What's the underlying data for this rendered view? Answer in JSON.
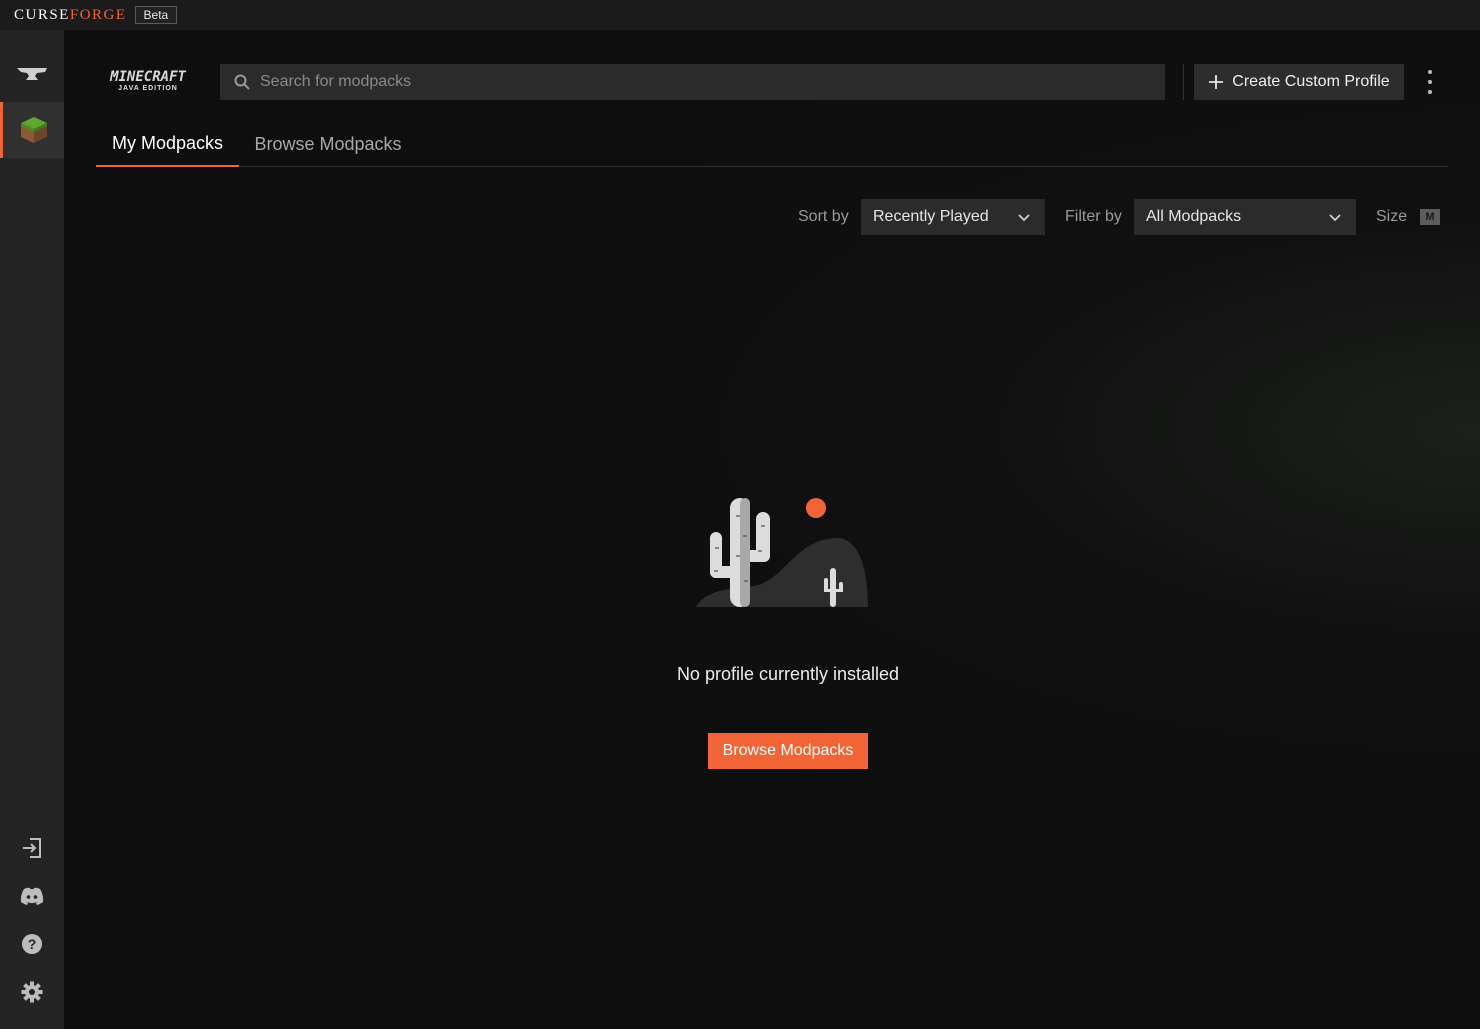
{
  "app": {
    "brand_curse": "CURSE",
    "brand_forge": "FORGE",
    "beta_label": "Beta"
  },
  "game": {
    "logo_line1": "MINECRAFT",
    "logo_line2": "JAVA EDITION"
  },
  "search": {
    "placeholder": "Search for modpacks",
    "value": ""
  },
  "header": {
    "create_label": "Create Custom Profile"
  },
  "tabs": [
    {
      "label": "My Modpacks",
      "active": true
    },
    {
      "label": "Browse Modpacks",
      "active": false
    }
  ],
  "toolbar": {
    "sort_label": "Sort by",
    "sort_value": "Recently Played",
    "filter_label": "Filter by",
    "filter_value": "All Modpacks",
    "size_label": "Size",
    "size_value": "M"
  },
  "empty_state": {
    "message": "No profile currently installed",
    "button_label": "Browse Modpacks"
  },
  "sidebar": {
    "top_items": [
      {
        "icon": "anvil-icon"
      },
      {
        "icon": "minecraft-grass-block-icon",
        "active": true
      }
    ],
    "bottom_items": [
      {
        "icon": "login-icon"
      },
      {
        "icon": "discord-icon"
      },
      {
        "icon": "help-icon"
      },
      {
        "icon": "settings-gear-icon"
      }
    ]
  },
  "colors": {
    "accent": "#f16436",
    "background": "#0e0e0e",
    "sidebar": "#242424",
    "titlebar": "#1b1b1b",
    "input_bg": "#2b2b2b"
  }
}
